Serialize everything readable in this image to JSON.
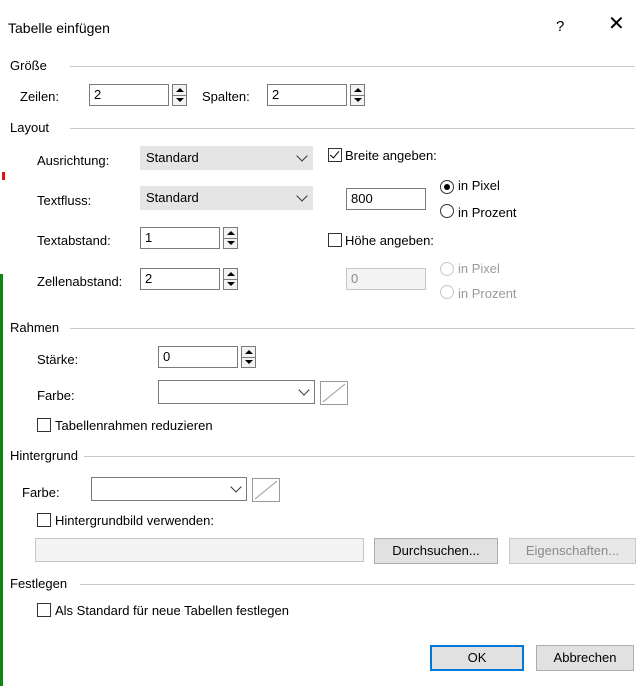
{
  "dialog": {
    "title": "Tabelle einfügen",
    "help": "?",
    "close": "✕"
  },
  "groesse": {
    "title": "Größe",
    "rows_label": "Zeilen:",
    "rows_value": "2",
    "cols_label": "Spalten:",
    "cols_value": "2"
  },
  "layout": {
    "title": "Layout",
    "alignment_label": "Ausrichtung:",
    "alignment_value": "Standard",
    "textflow_label": "Textfluss:",
    "textflow_value": "Standard",
    "padding_label": "Textabstand:",
    "padding_value": "1",
    "spacing_label": "Zellenabstand:",
    "spacing_value": "2",
    "width_check_label": "Breite angeben:",
    "width_checked": true,
    "width_value": "800",
    "width_unit_pixel": "in Pixel",
    "width_unit_percent": "in Prozent",
    "width_unit_selected": "pixel",
    "height_check_label": "Höhe angeben:",
    "height_checked": false,
    "height_value": "0",
    "height_unit_pixel": "in Pixel",
    "height_unit_percent": "in Prozent"
  },
  "rahmen": {
    "title": "Rahmen",
    "thickness_label": "Stärke:",
    "thickness_value": "0",
    "color_label": "Farbe:",
    "color_value": "",
    "collapse_label": "Tabellenrahmen reduzieren",
    "collapse_checked": false
  },
  "hintergrund": {
    "title": "Hintergrund",
    "color_label": "Farbe:",
    "color_value": "",
    "image_label": "Hintergrundbild verwenden:",
    "image_checked": false,
    "image_path": "",
    "browse_button": "Durchsuchen...",
    "properties_button": "Eigenschaften..."
  },
  "festlegen": {
    "title": "Festlegen",
    "default_label": "Als Standard für neue Tabellen festlegen",
    "default_checked": false
  },
  "buttons": {
    "ok": "OK",
    "cancel": "Abbrechen"
  },
  "colors": {
    "accent": "#0078d7",
    "combo_grey": "#e5e5e5",
    "left_edge_green": "#1f7a1f",
    "left_edge_red": "#c21f1f"
  }
}
